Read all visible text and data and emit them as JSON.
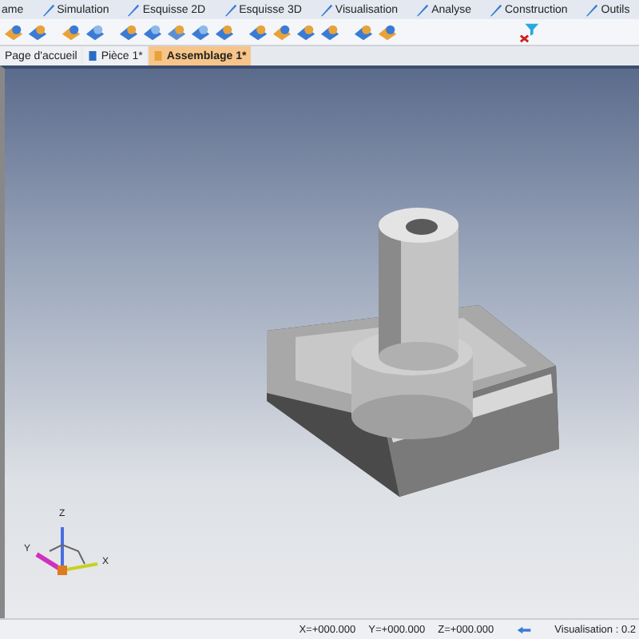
{
  "ribbon_tabs": [
    {
      "label": "ame"
    },
    {
      "label": "Simulation"
    },
    {
      "label": "Esquisse 2D"
    },
    {
      "label": "Esquisse 3D"
    },
    {
      "label": "Visualisation"
    },
    {
      "label": "Analyse"
    },
    {
      "label": "Construction"
    },
    {
      "label": "Outils"
    }
  ],
  "document_tabs": [
    {
      "label": "Page d'accueil",
      "selected": false
    },
    {
      "label": "Pièce 1*",
      "selected": false
    },
    {
      "label": "Assemblage 1*",
      "selected": true
    }
  ],
  "axis_labels": {
    "z": "Z",
    "y": "Y",
    "x": "X"
  },
  "status_bar": {
    "x": "X=+000.000",
    "y": "Y=+000.000",
    "z": "Z=+000.000",
    "view": "Visualisation : 0.2"
  }
}
